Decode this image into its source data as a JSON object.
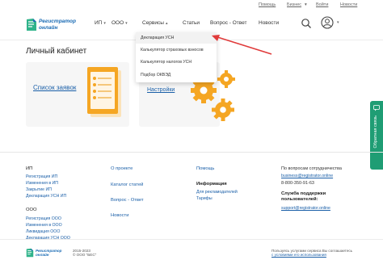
{
  "topbar": {
    "links": [
      "Помощь",
      "Бизнес",
      "Войти",
      "Новости"
    ],
    "chevron": "▾"
  },
  "logo": {
    "line1": "Регистратор",
    "line2": "онлайн"
  },
  "nav": [
    {
      "label": "ИП",
      "has_menu": true
    },
    {
      "label": "ООО",
      "has_menu": true
    },
    {
      "label": "Сервисы",
      "has_menu": true
    },
    {
      "label": "Статьи",
      "has_menu": false
    },
    {
      "label": "Вопрос - Ответ",
      "has_menu": false
    },
    {
      "label": "Новости",
      "has_menu": false
    }
  ],
  "nav_chevron": "▾",
  "icons": {
    "search": "search-icon",
    "user": "user-icon",
    "arrow": "red-arrow-annotation"
  },
  "dropdown": {
    "items": [
      "Декларация УСН",
      "Калькулятор страховых взносов",
      "Калькулятор налогов УСН",
      "Подбор ОКВЭД"
    ],
    "highlighted": 0
  },
  "page_title": "Личный кабинет",
  "cards": [
    {
      "title": "Список заявок"
    },
    {
      "title": "Настройки"
    }
  ],
  "feedback": {
    "label": "Обратная связь"
  },
  "footer": {
    "ip": {
      "heading": "ИП",
      "items": [
        "Регистрация ИП",
        "Изменения в ИП",
        "Закрытие ИП",
        "Декларация УСН ИП"
      ]
    },
    "ooo": {
      "heading": "ООО",
      "items": [
        "Регистрация ООО",
        "Изменения в ООО",
        "Ликвидация ООО",
        "Декларация УСН ООО"
      ]
    },
    "col2": [
      "О проекте",
      "Каталог статей",
      "Вопрос - Ответ",
      "Новости"
    ],
    "col3": {
      "help": "Помощь",
      "info_heading": "Информация",
      "info_items": [
        "Для рекламодателей",
        "Тарифы"
      ]
    },
    "col4": {
      "heading": "По вопросам сотрудничества",
      "email1": "business@registrator.online",
      "phone": "8-800-350-91-63",
      "support_heading": "Служба поддержки пользователей:",
      "email2": "support@registrator.online"
    }
  },
  "bottom": {
    "copyright_line1": "2015-2023",
    "copyright_line2": "© ООО \"БЕС\"",
    "right_line1": "Пользуясь услугами сервиса Вы соглашаетесь",
    "right_line2": "с условиями его использования"
  },
  "colors": {
    "accent": "#1a5fa8",
    "brand": "#1a6bb4",
    "feedback": "#1f9d74",
    "arrow": "#e03b3b",
    "illustration": "#f5a623"
  }
}
